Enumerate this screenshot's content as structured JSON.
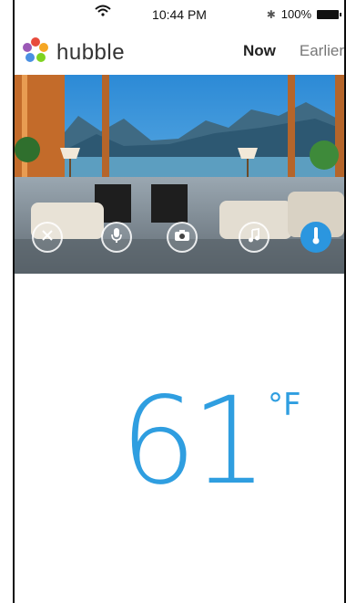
{
  "status": {
    "time": "10:44 PM",
    "battery": "100%"
  },
  "header": {
    "brand": "hubble",
    "tabs": [
      {
        "label": "Now"
      },
      {
        "label": "Earlier"
      }
    ]
  },
  "controls": [
    {
      "icon": "pan-tilt-icon",
      "active": false
    },
    {
      "icon": "microphone-icon",
      "active": false
    },
    {
      "icon": "camera-icon",
      "active": false
    },
    {
      "icon": "music-note-icon",
      "active": false
    },
    {
      "icon": "thermometer-icon",
      "active": true
    }
  ],
  "temperature": {
    "value": "61",
    "unit": "°F",
    "color": "#2f9ee0"
  },
  "colors": {
    "accent": "#2b96df",
    "brand_text": "#333333"
  }
}
